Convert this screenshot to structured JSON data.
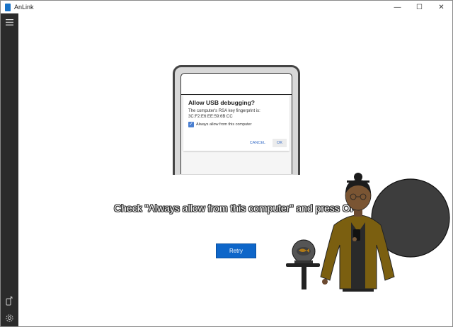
{
  "window": {
    "title": "AnLink",
    "minimize": "—",
    "maximize": "☐",
    "close": "✕"
  },
  "sidebar": {
    "menu_icon": "hamburger-menu-icon",
    "device_icon": "phone-connect-icon",
    "settings_icon": "gear-icon"
  },
  "phone_dialog": {
    "title": "Allow USB debugging?",
    "body_line1": "The computer's RSA key fingerprint is:",
    "body_line2": "3C:F2:E6:EE:59:6B:CC",
    "checkbox_label": "Always allow from this computer",
    "checkbox_checked": true,
    "cancel_label": "CANCEL",
    "ok_label": "OK"
  },
  "main": {
    "instruction": "Check \"Always allow from this computer\" and press OK",
    "retry_label": "Retry"
  },
  "colors": {
    "accent": "#0e66c9",
    "sidebar": "#2b2b2b",
    "checkbox": "#4a7fd1"
  }
}
